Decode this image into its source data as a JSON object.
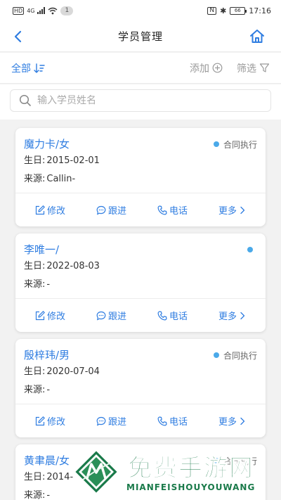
{
  "status_bar": {
    "network": "4G",
    "notification_count": "1",
    "battery": "66",
    "time": "17:16"
  },
  "nav": {
    "title": "学员管理"
  },
  "filter": {
    "all_label": "全部",
    "add_label": "添加",
    "filter_label": "筛选"
  },
  "search": {
    "placeholder": "输入学员姓名",
    "value": ""
  },
  "students": [
    {
      "name": "魔力卡/女",
      "status": "合同执行",
      "birthday_label": "生日:",
      "birthday": "2015-02-01",
      "source_label": "来源:",
      "source": "Callin-"
    },
    {
      "name": "李唯一/",
      "status": "",
      "birthday_label": "生日:",
      "birthday": "2022-08-03",
      "source_label": "来源:",
      "source": "-"
    },
    {
      "name": "殷梓玮/男",
      "status": "合同执行",
      "birthday_label": "生日:",
      "birthday": "2020-07-04",
      "source_label": "来源:",
      "source": "-"
    },
    {
      "name": "黄聿晨/女",
      "status": "合同执行",
      "birthday_label": "生日:",
      "birthday": "2014-",
      "source_label": "来源:",
      "source": "-"
    }
  ],
  "actions": {
    "edit": "修改",
    "follow": "跟进",
    "phone": "电话",
    "more": "更多"
  },
  "watermark": {
    "title": "免费手游网",
    "subtitle": "MIANFEISHOUYOUWANG"
  },
  "colors": {
    "accent": "#2f7de1",
    "status_dot": "#4aa9e9",
    "watermark": "#1a7a4a"
  }
}
